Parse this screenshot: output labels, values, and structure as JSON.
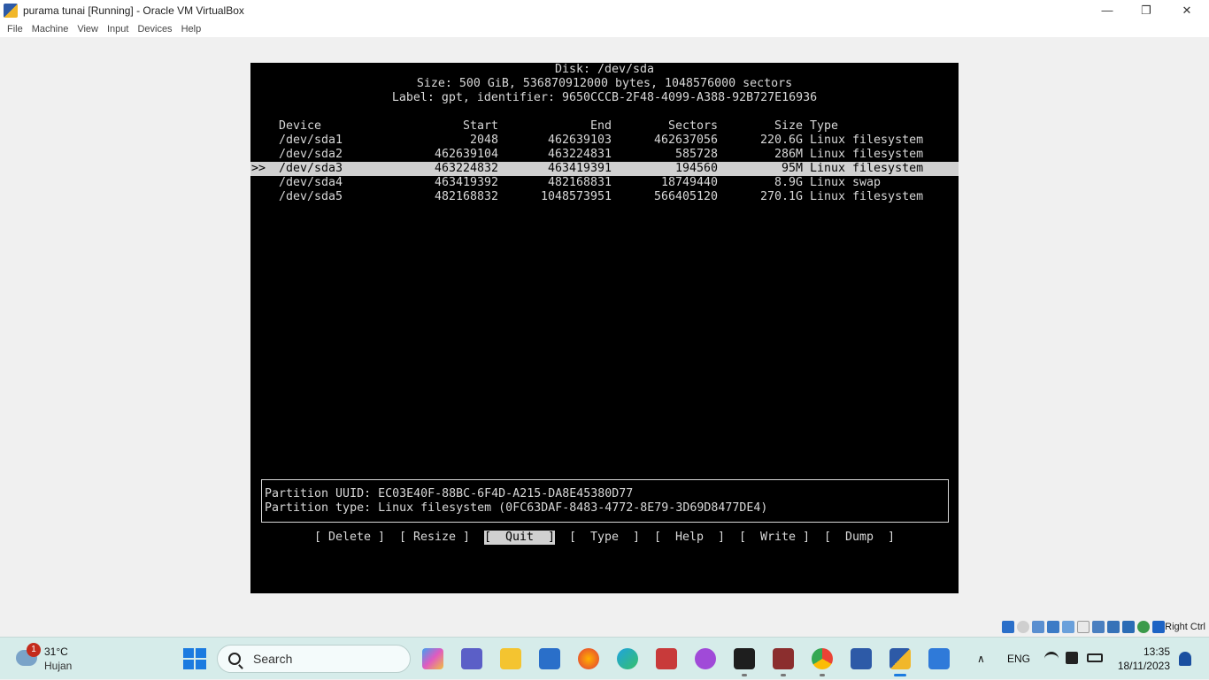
{
  "window": {
    "title": "purama tunai [Running] - Oracle VM VirtualBox",
    "minimize_glyph": "—",
    "restore_glyph": "❐",
    "close_glyph": "✕"
  },
  "menu": [
    "File",
    "Machine",
    "View",
    "Input",
    "Devices",
    "Help"
  ],
  "terminal": {
    "disk_line": "Disk: /dev/sda",
    "size_line": "Size: 500 GiB, 536870912000 bytes, 1048576000 sectors",
    "label_line": "Label: gpt, identifier: 9650CCCB-2F48-4099-A388-92B727E16936",
    "columns": {
      "device": "Device",
      "start": "Start",
      "end": "End",
      "sectors": "Sectors",
      "size": "Size",
      "type": "Type"
    },
    "selected_marker": ">>",
    "partitions": [
      {
        "device": "/dev/sda1",
        "start": "2048",
        "end": "462639103",
        "sectors": "462637056",
        "size": "220.6G",
        "type": "Linux filesystem"
      },
      {
        "device": "/dev/sda2",
        "start": "462639104",
        "end": "463224831",
        "sectors": "585728",
        "size": "286M",
        "type": "Linux filesystem"
      },
      {
        "device": "/dev/sda3",
        "start": "463224832",
        "end": "463419391",
        "sectors": "194560",
        "size": "95M",
        "type": "Linux filesystem"
      },
      {
        "device": "/dev/sda4",
        "start": "463419392",
        "end": "482168831",
        "sectors": "18749440",
        "size": "8.9G",
        "type": "Linux swap"
      },
      {
        "device": "/dev/sda5",
        "start": "482168832",
        "end": "1048573951",
        "sectors": "566405120",
        "size": "270.1G",
        "type": "Linux filesystem"
      }
    ],
    "info": {
      "uuid_line": "Partition UUID: EC03E40F-88BC-6F4D-A215-DA8E45380D77",
      "type_line": "Partition type: Linux filesystem (0FC63DAF-8483-4772-8E79-3D69D8477DE4)"
    },
    "actions": [
      "[ Delete ]",
      "[ Resize ]",
      "[  Quit  ]",
      "[  Type  ]",
      "[  Help  ]",
      "[  Write ]",
      "[  Dump  ]"
    ]
  },
  "status": {
    "right_ctrl": "Right Ctrl"
  },
  "taskbar": {
    "weather_badge": "1",
    "temperature": "31°C",
    "condition": "Hujan",
    "search_placeholder": "Search",
    "language": "ENG",
    "time": "13:35",
    "date": "18/11/2023",
    "chevron": "∧"
  },
  "colors": {
    "terminal_bg": "#000000",
    "terminal_fg": "#d8d8d8",
    "selection_bg": "#d0d0d0",
    "taskbar_bg": "#d6ecea"
  }
}
